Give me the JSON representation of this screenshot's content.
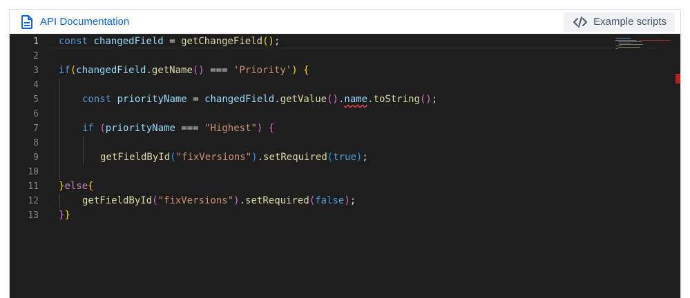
{
  "toolbar": {
    "doc_link_label": "API Documentation",
    "example_scripts_label": "Example scripts"
  },
  "editor": {
    "line_numbers": [
      "1",
      "2",
      "3",
      "4",
      "5",
      "6",
      "7",
      "8",
      "9",
      "10",
      "11",
      "12",
      "13"
    ],
    "active_line": 1
  },
  "colors": {
    "link": "#0c66e4",
    "editor_bg": "#1e1e1e",
    "keyword": "#569cd6",
    "string": "#ce9178",
    "function": "#dcdcaa",
    "error": "#f14c4c"
  },
  "code": {
    "l1": {
      "kw": "const",
      "var": "changedField",
      "op": "=",
      "fn": "getChangeField",
      "open": "(",
      "close": ")",
      "end": ";"
    },
    "l3": {
      "kw": "if",
      "open": "(",
      "obj": "changedField",
      "dot": ".",
      "fn": "getName",
      "p_open": "(",
      "p_close": ")",
      "op": "===",
      "str": "'Priority'",
      "close": ")",
      "brace": "{"
    },
    "l5": {
      "kw": "const",
      "var": "priorityName",
      "op": "=",
      "obj": "changedField",
      "dot1": ".",
      "fn1": "getValue",
      "p1": "()",
      "dot2": ".",
      "prop": "name",
      "dot3": ".",
      "fn2": "toString",
      "p2": "()",
      "end": ";"
    },
    "l7": {
      "kw": "if",
      "open": "(",
      "var": "priorityName",
      "op": "===",
      "str": "\"Highest\"",
      "close": ")",
      "brace": "{"
    },
    "l9": {
      "fn1": "getFieldById",
      "open1": "(",
      "str": "\"fixVersions\"",
      "close1": ")",
      "dot": ".",
      "fn2": "setRequired",
      "open2": "(",
      "val": "true",
      "close2": ")",
      "end": ";"
    },
    "l11": {
      "brace": "}",
      "kw": "else",
      "open": "{"
    },
    "l12": {
      "fn1": "getFieldById",
      "open1": "(",
      "str": "\"fixVersions\"",
      "close1": ")",
      "dot": ".",
      "fn2": "setRequired",
      "open2": "(",
      "val": "false",
      "close2": ")",
      "end": ";"
    },
    "l13": {
      "b1": "}",
      "b2": "}"
    }
  }
}
